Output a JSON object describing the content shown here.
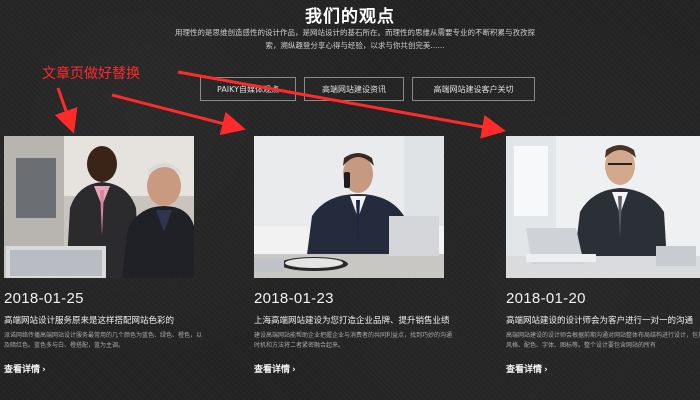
{
  "section": {
    "title": "我们的观点",
    "description": "用理性的是思维创造感性的设计作品，是网站设计的基石所在。而理性的思维从需要专业的不断积累与孜孜探索，溯纵趣登分享心得与经验，以求与你共创完美......"
  },
  "annotation": {
    "text": "文章页做好替换",
    "color": "#ff2b2b"
  },
  "tabs": [
    {
      "label": "PAIKY自媒体观点"
    },
    {
      "label": "高端网站建设资讯"
    },
    {
      "label": "高端网站建设客户关切"
    }
  ],
  "cards": [
    {
      "date": "2018-01-25",
      "title": "高端网站设计服务原来是这样搭配网站色彩的",
      "excerpt": "派诺网络传播高端网站设计服务最常用的几个颜色为蓝色、绿色、橙色，以及暗红色。蓝色多与白、橙搭配，蓝为主调。",
      "more": "查看详情"
    },
    {
      "date": "2018-01-23",
      "title": "上海高端网站建设为您打造企业品牌、提升销售业绩",
      "excerpt": "建设高端网站能帮助企业把握企业与消费者的共同利益点，找到巧妙的沟通时机和方法将二者紧密融合起来。",
      "more": "查看详情"
    },
    {
      "date": "2018-01-20",
      "title": "高端网站建设的设计师会为客户进行一对一的沟通",
      "excerpt": "高端网站建设的设计师会根据前期沟通对网站整体布局结构进行设计，包括风格、配色、字体、图标等。整个设计要包含网站的所有",
      "more": "查看详情"
    }
  ],
  "colors": {
    "background": "#232323",
    "accent_arrow": "#ff2b2b",
    "text": "#ffffff"
  },
  "icons": {
    "more": "chevron-right-icon"
  }
}
